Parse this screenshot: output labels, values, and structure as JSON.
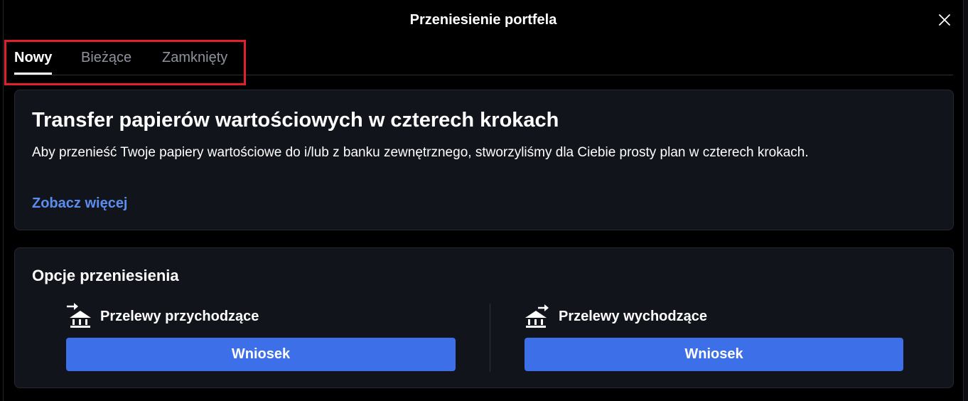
{
  "modal": {
    "title": "Przeniesienie portfela"
  },
  "tabs": [
    {
      "label": "Nowy",
      "active": true
    },
    {
      "label": "Bieżące",
      "active": false
    },
    {
      "label": "Zamknięty",
      "active": false
    }
  ],
  "info": {
    "title": "Transfer papierów wartościowych w czterech krokach",
    "description": "Aby przenieść Twoje papiery wartościowe do i/lub z banku zewnętrznego, stworzyliśmy dla Ciebie prosty plan w czterech krokach.",
    "link_label": "Zobacz więcej"
  },
  "options": {
    "title": "Opcje przeniesienia",
    "incoming": {
      "label": "Przelewy przychodzące",
      "icon": "bank-incoming-icon",
      "button_label": "Wniosek"
    },
    "outgoing": {
      "label": "Przelewy wychodzące",
      "icon": "bank-outgoing-icon",
      "button_label": "Wniosek"
    }
  },
  "colors": {
    "accent": "#3d6fe8",
    "link": "#5b8df0",
    "highlight": "#e0202a",
    "card_bg": "#12141b"
  }
}
